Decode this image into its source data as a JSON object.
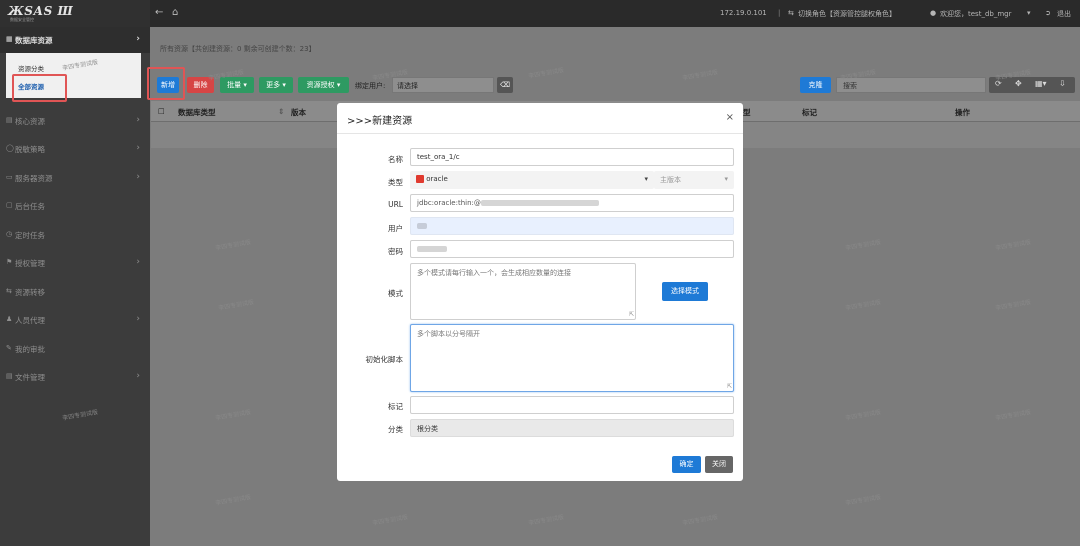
{
  "topbar": {
    "ip": "172.19.0.101",
    "switch_role": "切换角色【资源管控腿权角色】",
    "welcome": "欢迎您，test_db_mgr",
    "logout": "退出"
  },
  "logo": {
    "text": "ЖЅАЅ Ш",
    "sub": "数据安全管控"
  },
  "sidebar": {
    "items": [
      {
        "label": "数据库资源"
      },
      {
        "label": "核心资源"
      },
      {
        "label": "脱敏策略"
      },
      {
        "label": "服务器资源"
      },
      {
        "label": "后台任务"
      },
      {
        "label": "定时任务"
      },
      {
        "label": "授权管理"
      },
      {
        "label": "资源转移"
      },
      {
        "label": "人员代理"
      },
      {
        "label": "我的审批"
      },
      {
        "label": "文件管理"
      }
    ],
    "sub": {
      "category": "资源分类",
      "all": "全部资源"
    }
  },
  "main": {
    "info": "所有资源【共创建资源：0  剩余可创建个数：23】",
    "toolbar": {
      "add": "新增",
      "delete": "删除",
      "batch": "批量",
      "more": "更多",
      "grant": "资源授权",
      "bind_user_label": "绑定用户:",
      "bind_user_value": "请选择",
      "clone": "克隆",
      "search_placeholder": "搜索"
    },
    "columns": {
      "db_type": "数据库类型",
      "version": "版本",
      "type": "型",
      "tag": "标记",
      "ops": "操作"
    },
    "watermark": "李四专测试版"
  },
  "modal": {
    "title": ">>>新建资源",
    "close": "×",
    "fields": {
      "name": {
        "label": "名称",
        "value": "test_ora_1/c"
      },
      "type": {
        "label": "类型",
        "value": "oracle",
        "version_placeholder": "主版本"
      },
      "url": {
        "label": "URL",
        "value": "jdbc:oracle:thin:@"
      },
      "user": {
        "label": "用户",
        "value": ""
      },
      "password": {
        "label": "密码",
        "value": ""
      },
      "schema": {
        "label": "模式",
        "placeholder": "多个模式请每行输入一个，会生成相应数量的连接",
        "select_button": "选择模式"
      },
      "init_script": {
        "label": "初始化脚本",
        "placeholder": "多个脚本以分号隔开"
      },
      "tag": {
        "label": "标记",
        "value": ""
      },
      "category": {
        "label": "分类",
        "value": "根分类"
      }
    },
    "ok": "确定",
    "cancel": "关闭"
  },
  "colors": {
    "blue": "#1e7ad6",
    "red": "#d64545",
    "green": "#2e9a62",
    "annotation": "#e05555"
  }
}
